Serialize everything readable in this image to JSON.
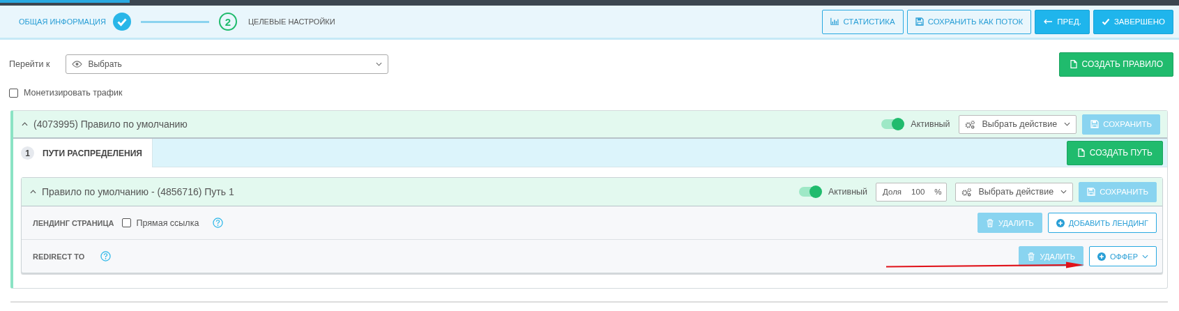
{
  "progress_bar": {
    "level": 0.11
  },
  "wizard": {
    "steps": [
      {
        "label": "ОБЩАЯ ИНФОРМАЦИЯ",
        "done": true
      },
      {
        "number": "2",
        "label": "ЦЕЛЕВЫЕ НАСТРОЙКИ",
        "done": false
      }
    ],
    "buttons": [
      {
        "label": "СТАТИСТИКА",
        "kind": "outline"
      },
      {
        "label": "СОХРАНИТЬ КАК ПОТОК",
        "kind": "outline"
      },
      {
        "label": "ПРЕД.",
        "kind": "primary"
      },
      {
        "label": "ЗАВЕРШЕНО",
        "kind": "primary"
      }
    ]
  },
  "goto": {
    "label": "Перейти к",
    "value": "Выбрать"
  },
  "create_rule_button": {
    "label": "СОЗДАТЬ ПРАВИЛО",
    "kind": "success"
  },
  "monetize": {
    "label": "Монетизировать трафик",
    "checked": false
  },
  "rule": {
    "title": "(4073995) Правило по умолчанию",
    "active": {
      "label": "Активный",
      "on": true
    },
    "action": "Выбрать действие",
    "save_button": {
      "label": "СОХРАНИТЬ",
      "kind": "faded"
    },
    "tabs": [
      {
        "number": "1",
        "label": "ПУТИ РАСПРЕДЕЛЕНИЯ",
        "selected": true
      }
    ],
    "create_path_button": {
      "label": "СОЗДАТЬ ПУТЬ",
      "kind": "success"
    },
    "path": {
      "title": "Правило по умолчанию - (4856716) Путь 1",
      "active": {
        "label": "Активный",
        "on": true
      },
      "share": {
        "label": "Доля",
        "value": "100",
        "unit": "%"
      },
      "action": "Выбрать действие",
      "save_button": {
        "label": "СОХРАНИТЬ",
        "kind": "faded"
      },
      "rows": [
        {
          "kind": "landing",
          "label": "ЛЕНДИНГ СТРАНИЦА",
          "checkbox": {
            "label": "Прямая ссылка",
            "checked": false
          },
          "buttons": [
            {
              "label": "УДАЛИТЬ",
              "kind": "faded"
            },
            {
              "label": "ДОБАВИТЬ ЛЕНДИНГ",
              "kind": "outline"
            }
          ]
        },
        {
          "kind": "redirect",
          "label": "REDIRECT TO",
          "buttons": [
            {
              "label": "УДАЛИТЬ",
              "kind": "faded"
            },
            {
              "label": "ОФФЕР",
              "kind": "outline"
            }
          ]
        }
      ]
    }
  }
}
